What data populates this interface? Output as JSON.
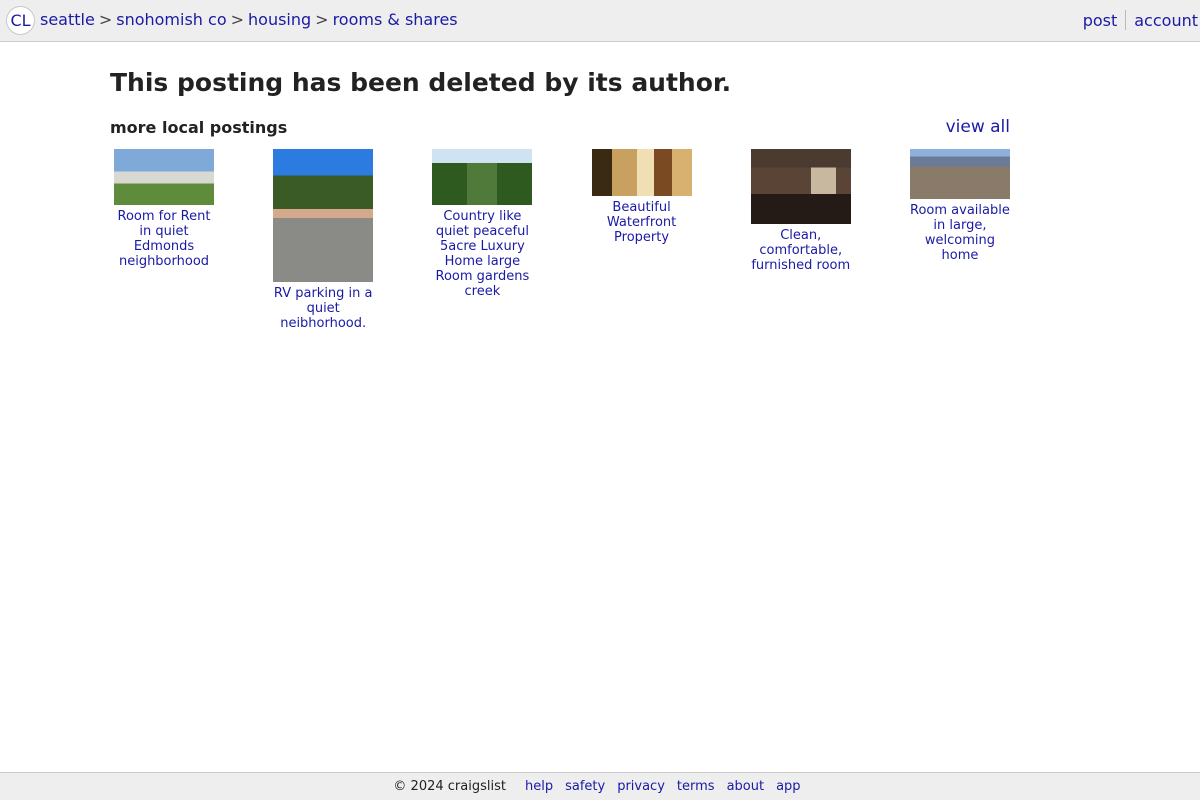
{
  "header": {
    "logo": "CL",
    "breadcrumbs": [
      {
        "label": "seattle"
      },
      {
        "label": "snohomish co"
      },
      {
        "label": "housing"
      },
      {
        "label": "rooms & shares"
      }
    ],
    "separator": ">",
    "post_label": "post",
    "account_label": "account"
  },
  "main": {
    "message": "This posting has been deleted by its author.",
    "more_local": "more local postings",
    "view_all": "view all",
    "postings": [
      {
        "title": "Room for Rent in quiet Edmonds neighborhood"
      },
      {
        "title": "RV parking in a quiet neibhorhood."
      },
      {
        "title": "Country like quiet peaceful 5acre Luxury Home large Room gardens creek"
      },
      {
        "title": "Beautiful Waterfront Property"
      },
      {
        "title": "Clean, comfortable, furnished room"
      },
      {
        "title": "Room available in large, welcoming home"
      }
    ]
  },
  "footer": {
    "copyright": "© 2024 craigslist",
    "links": [
      "help",
      "safety",
      "privacy",
      "terms",
      "about",
      "app"
    ]
  },
  "colors": {
    "link": "#1a1aa6",
    "bar_bg": "#eeeeee",
    "text": "#222222"
  }
}
